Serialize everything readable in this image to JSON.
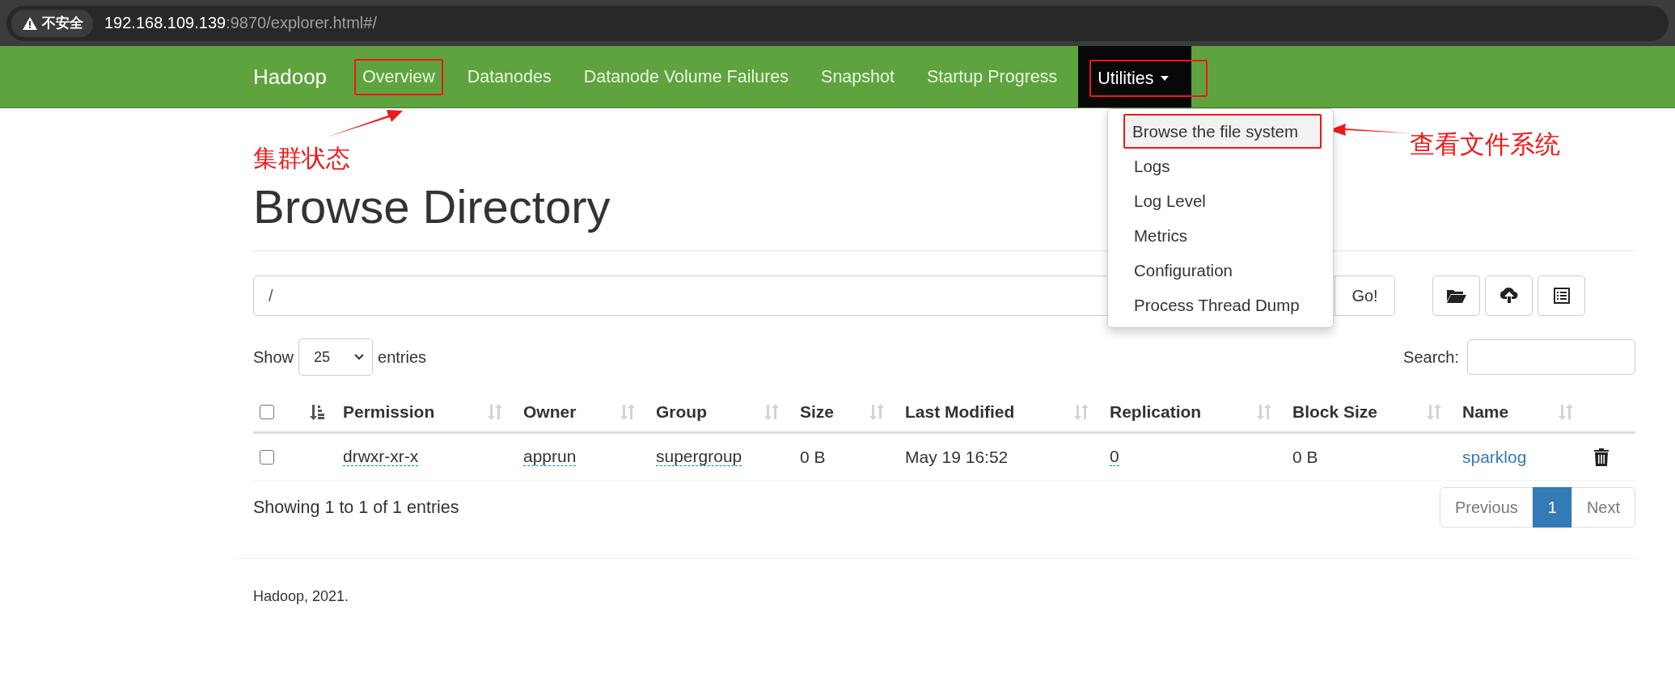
{
  "browser": {
    "security": "不安全",
    "url_host": "192.168.109.139",
    "url_rest": ":9870/explorer.html#/"
  },
  "navbar": {
    "brand": "Hadoop",
    "items": [
      {
        "label": "Overview",
        "kind": "link",
        "expanded": false,
        "annotated": true
      },
      {
        "label": "Datanodes",
        "kind": "link",
        "expanded": false,
        "annotated": false
      },
      {
        "label": "Datanode Volume Failures",
        "kind": "link",
        "expanded": false,
        "annotated": false
      },
      {
        "label": "Snapshot",
        "kind": "link",
        "expanded": false,
        "annotated": false
      },
      {
        "label": "Startup Progress",
        "kind": "link",
        "expanded": false,
        "annotated": false
      },
      {
        "label": "Utilities",
        "kind": "dropdown",
        "expanded": true,
        "annotated": true
      }
    ]
  },
  "dropdown": [
    {
      "label": "Browse the file system",
      "selected": true,
      "annotated": true
    },
    {
      "label": "Logs",
      "selected": false,
      "annotated": false
    },
    {
      "label": "Log Level",
      "selected": false,
      "annotated": false
    },
    {
      "label": "Metrics",
      "selected": false,
      "annotated": false
    },
    {
      "label": "Configuration",
      "selected": false,
      "annotated": false
    },
    {
      "label": "Process Thread Dump",
      "selected": false,
      "annotated": false
    }
  ],
  "annotations": [
    {
      "text": "集群状态"
    },
    {
      "text": "查看文件系统"
    }
  ],
  "title": "Browse Directory",
  "path": {
    "value": "/",
    "button": "Go!"
  },
  "length": {
    "before": "Show",
    "value": "25",
    "after": "entries"
  },
  "search": {
    "label": "Search:"
  },
  "table": {
    "select_all": {
      "checked": false
    },
    "columns": [
      {
        "sorted": true
      },
      {
        "label": "Permission",
        "sorted": false
      },
      {
        "label": "Owner",
        "sorted": false
      },
      {
        "label": "Group",
        "sorted": false
      },
      {
        "label": "Size",
        "sorted": false
      },
      {
        "label": "Last Modified",
        "sorted": false
      },
      {
        "label": "Replication",
        "sorted": false
      },
      {
        "label": "Block Size",
        "sorted": false
      },
      {
        "label": "Name",
        "sorted": false
      }
    ],
    "rows": [
      {
        "checked": false,
        "permission": "drwxr-xr-x",
        "owner": "apprun",
        "group": "supergroup",
        "size": "0 B",
        "last_modified": "May 19 16:52",
        "replication": "0",
        "block_size": "0 B",
        "name": "sparklog"
      }
    ]
  },
  "info": "Showing 1 to 1 of 1 entries",
  "pagination": [
    {
      "label": "Previous",
      "selected": false
    },
    {
      "label": "1",
      "selected": true
    },
    {
      "label": "Next",
      "selected": false
    }
  ],
  "footer": "Hadoop, 2021."
}
